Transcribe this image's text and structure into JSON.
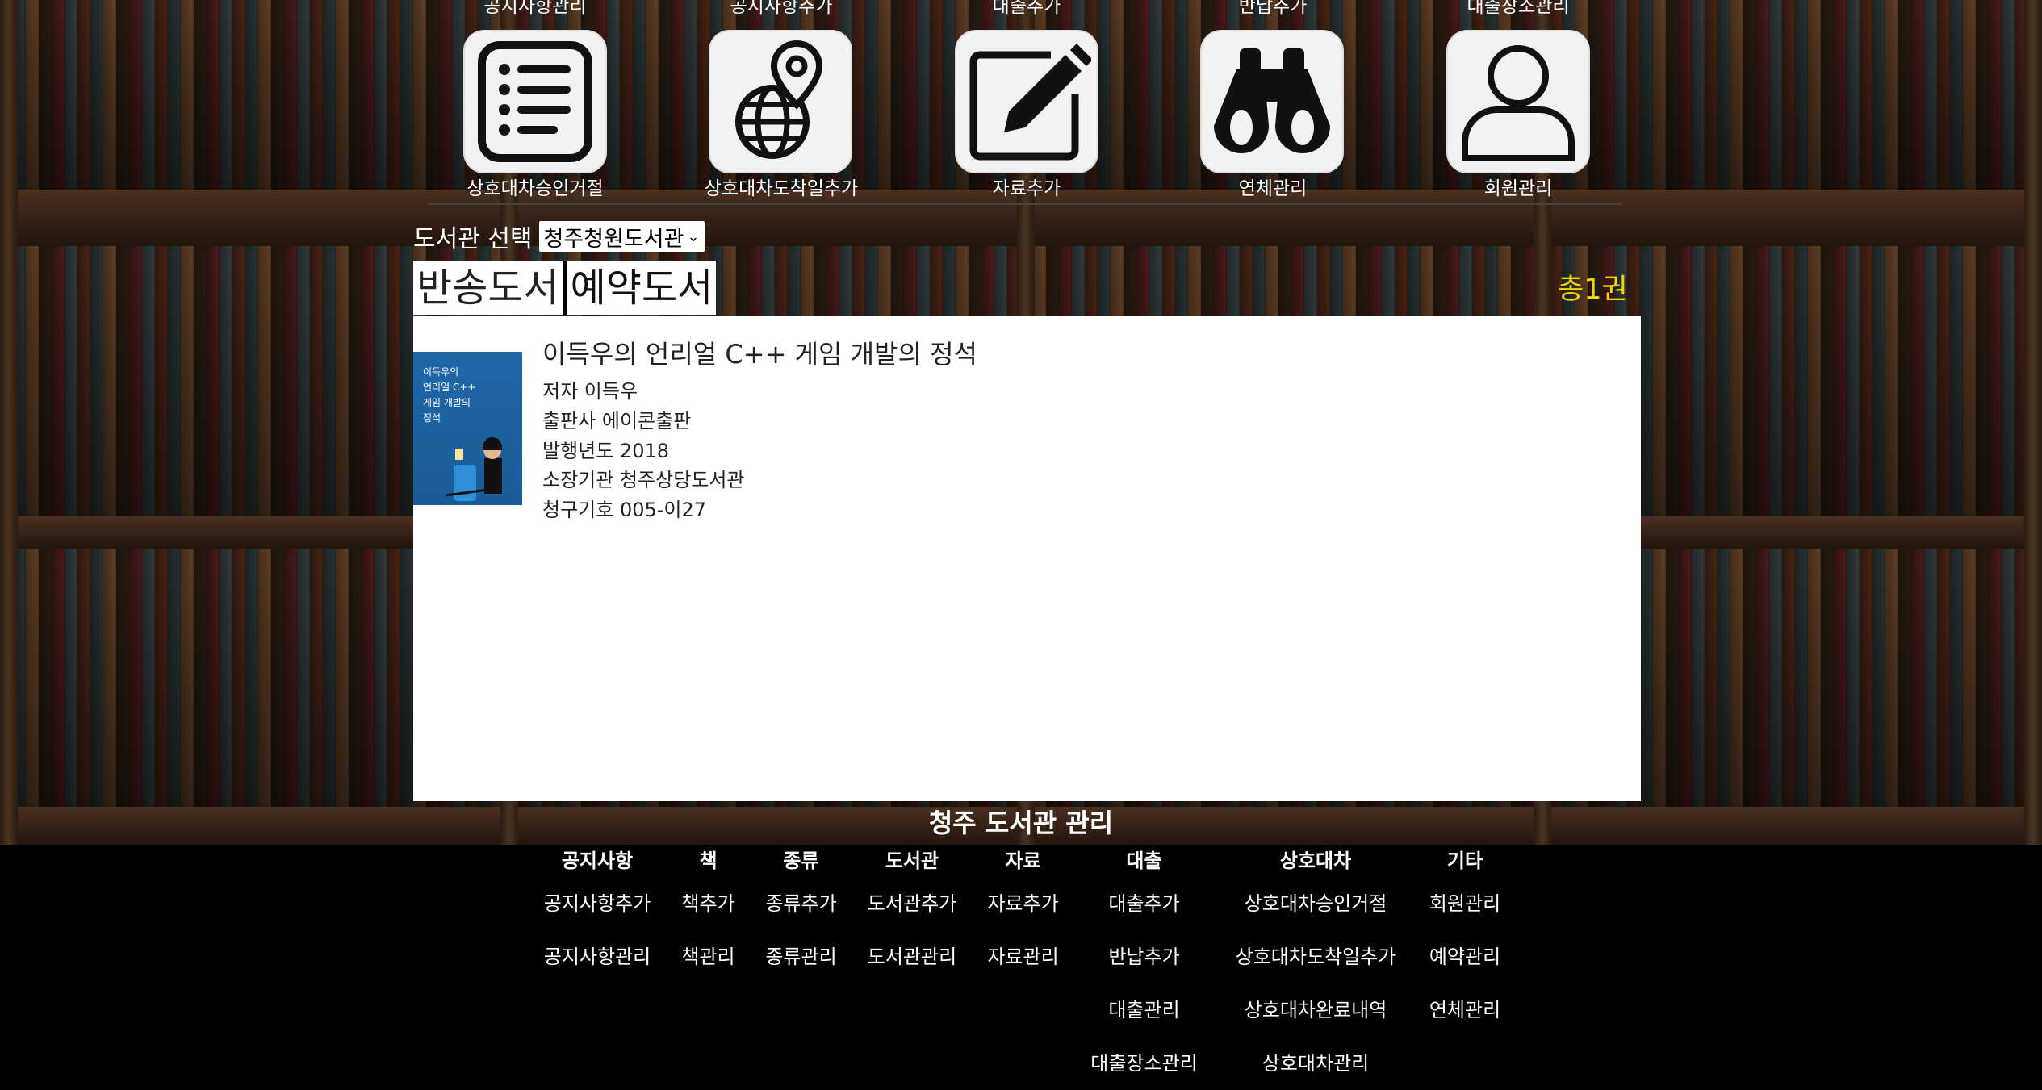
{
  "top_menu": {
    "cut_labels": [
      "공지사항관리",
      "공지사항추가",
      "대출추가",
      "반납추가",
      "대출장소관리"
    ],
    "tiles": [
      {
        "label": "상호대차승인거절",
        "icon": "list-icon"
      },
      {
        "label": "상호대차도착일추가",
        "icon": "globe-pin-icon"
      },
      {
        "label": "자료추가",
        "icon": "pencil-icon"
      },
      {
        "label": "연체관리",
        "icon": "binoculars-icon"
      },
      {
        "label": "회원관리",
        "icon": "user-icon"
      }
    ]
  },
  "library_selector": {
    "label": "도서관 선택",
    "selected": "청주청원도서관"
  },
  "tabs": [
    {
      "label": "반송도서",
      "active": true
    },
    {
      "label": "예약도서",
      "active": false
    }
  ],
  "total_label": "총1권",
  "book": {
    "cover_text": "이득우의\n언리얼 C++\n게임 개발의\n정석",
    "title": "이득우의 언리얼 C++ 게임 개발의 정석",
    "author": "저자 이득우",
    "publisher": "출판사 에이콘출판",
    "year": "발행년도 2018",
    "holding": "소장기관 청주상당도서관",
    "call_number": "청구기호 005-이27"
  },
  "footer": {
    "title": "청주 도서관 관리",
    "columns": [
      {
        "heading": "공지사항",
        "items": [
          "공지사항추가",
          "공지사항관리"
        ]
      },
      {
        "heading": "책",
        "items": [
          "책추가",
          "책관리"
        ]
      },
      {
        "heading": "종류",
        "items": [
          "종류추가",
          "종류관리"
        ]
      },
      {
        "heading": "도서관",
        "items": [
          "도서관추가",
          "도서관관리"
        ]
      },
      {
        "heading": "자료",
        "items": [
          "자료추가",
          "자료관리"
        ]
      },
      {
        "heading": "대출",
        "items": [
          "대출추가",
          "반납추가",
          "대출관리",
          "대출장소관리"
        ]
      },
      {
        "heading": "상호대차",
        "items": [
          "상호대차승인거절",
          "상호대차도착일추가",
          "상호대차완료내역",
          "상호대차관리"
        ]
      },
      {
        "heading": "기타",
        "items": [
          "회원관리",
          "예약관리",
          "연체관리"
        ]
      }
    ]
  }
}
